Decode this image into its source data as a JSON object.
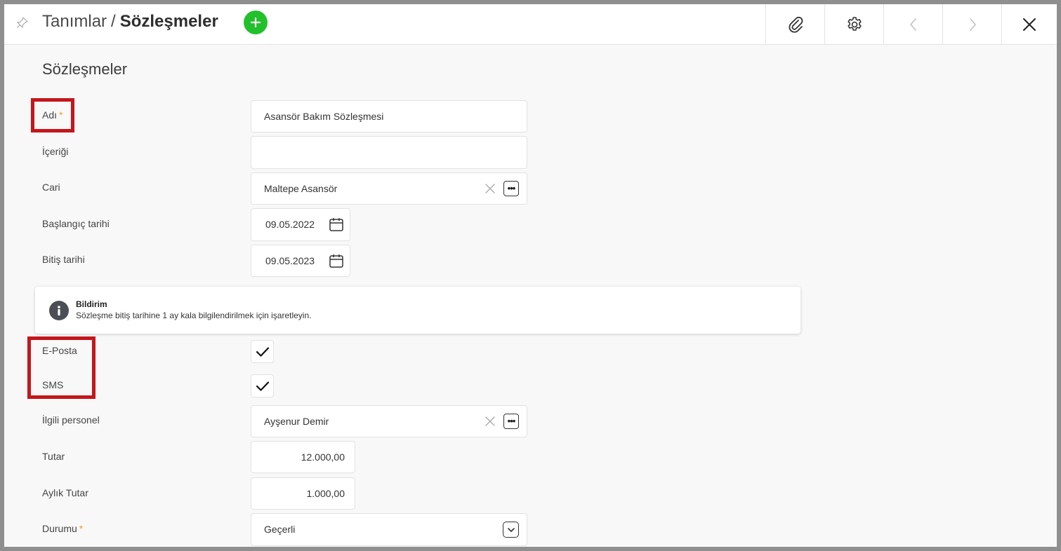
{
  "header": {
    "breadcrumb_parent": "Tanımlar",
    "breadcrumb_separator": "/",
    "breadcrumb_current": "Sözleşmeler",
    "icons": [
      "pin-icon",
      "add-icon",
      "paperclip-icon",
      "gear-icon",
      "chevron-left-icon",
      "chevron-right-icon",
      "close-icon"
    ]
  },
  "section_title": "Sözleşmeler",
  "form": {
    "adi": {
      "label": "Adı",
      "required_mark": "*",
      "value": "Asansör Bakım Sözleşmesi"
    },
    "icerigi": {
      "label": "İçeriği",
      "value": ""
    },
    "cari": {
      "label": "Cari",
      "value": "Maltepe Asansör"
    },
    "baslangic": {
      "label": "Başlangıç tarihi",
      "value": "09.05.2022"
    },
    "bitis": {
      "label": "Bitiş tarihi",
      "value": "09.05.2023"
    },
    "eposta": {
      "label": "E-Posta",
      "checked": true
    },
    "sms": {
      "label": "SMS",
      "checked": true
    },
    "personel": {
      "label": "İlgili personel",
      "value": "Ayşenur Demir"
    },
    "tutar": {
      "label": "Tutar",
      "value": "12.000,00"
    },
    "aylik_tutar": {
      "label": "Aylık Tutar",
      "value": "1.000,00"
    },
    "durumu": {
      "label": "Durumu",
      "required_mark": "*",
      "value": "Geçerli"
    }
  },
  "notice": {
    "title": "Bildirim",
    "text": "Sözleşme bitiş tarihine 1 ay kala bilgilendirilmek için işaretleyin."
  },
  "colors": {
    "accent_green": "#22c02b",
    "highlight_red": "#c4161c",
    "required_orange": "#f0a020"
  }
}
